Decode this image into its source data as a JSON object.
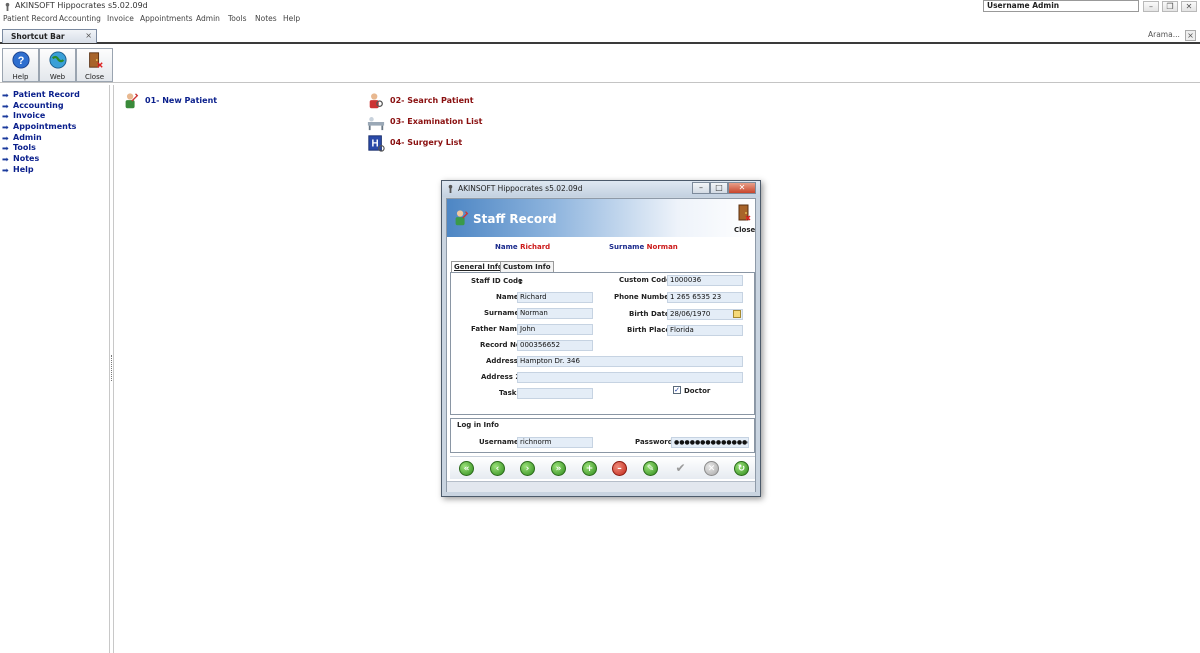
{
  "window": {
    "title": "AKINSOFT Hippocrates s5.02.09d",
    "username_box": "Username Admin"
  },
  "menubar": [
    "Patient Record",
    "Accounting",
    "Invoice",
    "Appointments",
    "Admin",
    "Tools",
    "Notes",
    "Help"
  ],
  "tabbar": {
    "tab_label": "Shortcut Bar",
    "tab_close": "×",
    "search_label": "Arama...",
    "search_close": "×"
  },
  "toolbar": {
    "help": "Help",
    "web": "Web",
    "close": "Close"
  },
  "leftnav": [
    "Patient Record",
    "Accounting",
    "Invoice",
    "Appointments",
    "Admin",
    "Tools",
    "Notes",
    "Help"
  ],
  "shortcuts": {
    "new_patient": "01- New Patient",
    "search_patient": "02- Search Patient",
    "examination_list": "03- Examination List",
    "surgery_list": "04- Surgery  List"
  },
  "dialog": {
    "title": "AKINSOFT Hippocrates s5.02.09d",
    "header_title": "Staff Record",
    "close_label": "Close",
    "name_label": "Name",
    "name_value": "Richard",
    "surname_label": "Surname",
    "surname_value": "Norman",
    "tabs": [
      "General Info",
      "Custom Info"
    ],
    "fields": {
      "staff_id_label": "Staff ID Code",
      "staff_id_value": "1",
      "name_label": "Name",
      "name_value": "Richard",
      "surname_label": "Surname",
      "surname_value": "Norman",
      "father_label": "Father Name",
      "father_value": "John",
      "record_label": "Record No",
      "record_value": "000356652",
      "address_label": "Address",
      "address_value": "Hampton Dr. 346",
      "address2_label": "Address 2",
      "address2_value": "",
      "task_label": "Task",
      "task_value": "",
      "custom_code_label": "Custom Code",
      "custom_code_value": "1000036",
      "phone_label": "Phone Number",
      "phone_value": "1 265 6535 23",
      "birth_date_label": "Birth Date",
      "birth_date_value": "28/06/1970",
      "birth_place_label": "Birth Place",
      "birth_place_value": "Florida",
      "doctor_label": "Doctor",
      "doctor_checked": true
    },
    "login": {
      "section_label": "Log in Info",
      "username_label": "Username",
      "username_value": "richnorm",
      "password_label": "Password",
      "password_value": "●●●●●●●●●●●●●●●●●"
    },
    "nav_buttons": [
      "first",
      "previous",
      "next",
      "last",
      "add",
      "delete",
      "edit",
      "save",
      "cancel",
      "refresh"
    ]
  }
}
